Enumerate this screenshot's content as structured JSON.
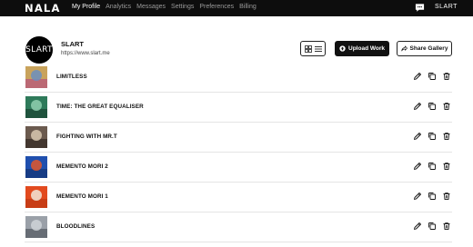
{
  "app": {
    "logo": "NALA",
    "nav": [
      "My Profile",
      "Analytics",
      "Messages",
      "Settings",
      "Preferences",
      "Billing"
    ],
    "active_nav": "My Profile",
    "user_badge": "SLART",
    "icons": {
      "messages": "chat-bubble-icon"
    }
  },
  "profile": {
    "avatar_text": "SLART",
    "name": "SLART",
    "url": "https://www.slart.me"
  },
  "toolbar": {
    "view_toggle_icons": [
      "grid-icon",
      "list-icon"
    ],
    "upload_label": "Upload Work",
    "upload_icon": "upload-icon",
    "share_label": "Share Gallery",
    "share_icon": "share-icon"
  },
  "works": [
    {
      "title": "LIMITLESS",
      "thumb_colors": [
        "#c9a35c",
        "#6b8fbf",
        "#b85a7a"
      ]
    },
    {
      "title": "TIME: THE GREAT EQUALISER",
      "thumb_colors": [
        "#2e7a5a",
        "#8fd0b0",
        "#1c4a36"
      ]
    },
    {
      "title": "FIGHTING WITH MR.T",
      "thumb_colors": [
        "#6b5a4e",
        "#d8c8b0",
        "#3a2e28"
      ]
    },
    {
      "title": "MEMENTO MORI 2",
      "thumb_colors": [
        "#1f4fae",
        "#e2572a",
        "#15377a"
      ]
    },
    {
      "title": "MEMENTO MORI 1",
      "thumb_colors": [
        "#e24a1e",
        "#f2e6d8",
        "#c23a14"
      ]
    },
    {
      "title": "BLOODLINES",
      "thumb_colors": [
        "#9aa0a8",
        "#cfd3d8",
        "#5a6068"
      ]
    }
  ],
  "row_actions": [
    "edit-pencil-icon",
    "duplicate-icon",
    "delete-trash-icon"
  ]
}
